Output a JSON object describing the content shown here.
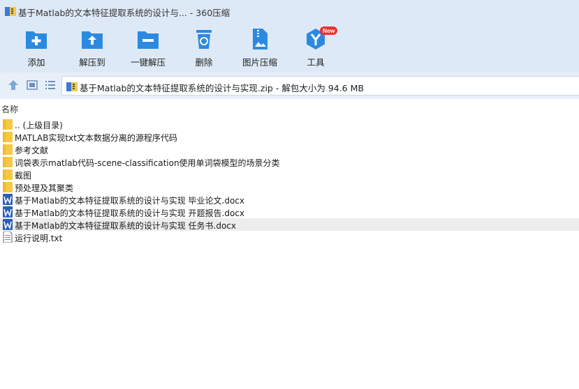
{
  "window": {
    "title": "基于Matlab的文本特征提取系统的设计与...  - 360压缩"
  },
  "toolbar": {
    "items": [
      {
        "label": "添加",
        "icon": "add-icon"
      },
      {
        "label": "解压到",
        "icon": "extract-to-icon"
      },
      {
        "label": "一键解压",
        "icon": "one-click-extract-icon"
      },
      {
        "label": "删除",
        "icon": "delete-icon"
      },
      {
        "label": "图片压缩",
        "icon": "image-compress-icon"
      },
      {
        "label": "工具",
        "icon": "tools-icon",
        "badge": "New"
      }
    ]
  },
  "navbar": {
    "path": "基于Matlab的文本特征提取系统的设计与实现.zip - 解包大小为 94.6 MB"
  },
  "list": {
    "column_name": "名称",
    "files": [
      {
        "name": ".. (上级目录)",
        "type": "folder"
      },
      {
        "name": "MATLAB实现txt文本数据分离的源程序代码",
        "type": "folder"
      },
      {
        "name": "参考文献",
        "type": "folder"
      },
      {
        "name": "词袋表示matlab代码-scene-classification使用单词袋模型的场景分类",
        "type": "folder"
      },
      {
        "name": "截图",
        "type": "folder"
      },
      {
        "name": "预处理及其聚类",
        "type": "folder"
      },
      {
        "name": "基于Matlab的文本特征提取系统的设计与实现 毕业论文.docx",
        "type": "docx"
      },
      {
        "name": "基于Matlab的文本特征提取系统的设计与实现 开题报告.docx",
        "type": "docx"
      },
      {
        "name": "基于Matlab的文本特征提取系统的设计与实现 任务书.docx",
        "type": "docx",
        "selected": true
      },
      {
        "name": "运行说明.txt",
        "type": "txt"
      }
    ]
  },
  "colors": {
    "accent": "#2b8ae0",
    "toolbar_bg": "#dde9f6",
    "folder": "#f7c942",
    "word": "#2b5fb8",
    "badge": "#e8332b"
  }
}
